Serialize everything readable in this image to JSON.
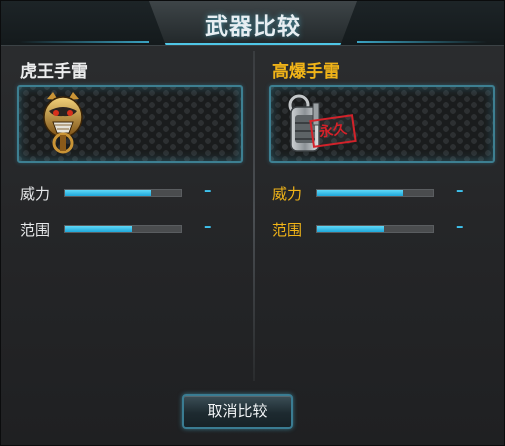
{
  "dialog": {
    "title": "武器比较",
    "cancel_label": "取消比较"
  },
  "left": {
    "weapon_name": "虎王手雷",
    "weapon_icon": "tiger-head-grenade-icon",
    "stats": [
      {
        "label": "威力",
        "fill": 0.74,
        "value": "–"
      },
      {
        "label": "范围",
        "fill": 0.58,
        "value": "–"
      }
    ]
  },
  "right": {
    "weapon_name": "高爆手雷",
    "weapon_icon": "high-explosive-grenade-icon",
    "stamp": "永久",
    "stats": [
      {
        "label": "威力",
        "fill": 0.74,
        "value": "–"
      },
      {
        "label": "范围",
        "fill": 0.58,
        "value": "–"
      }
    ]
  },
  "colors": {
    "accent": "#4fc6e6",
    "bar_fill": "#1ea7d9",
    "highlight_name": "#f1b418",
    "stamp_red": "#d3222a"
  }
}
